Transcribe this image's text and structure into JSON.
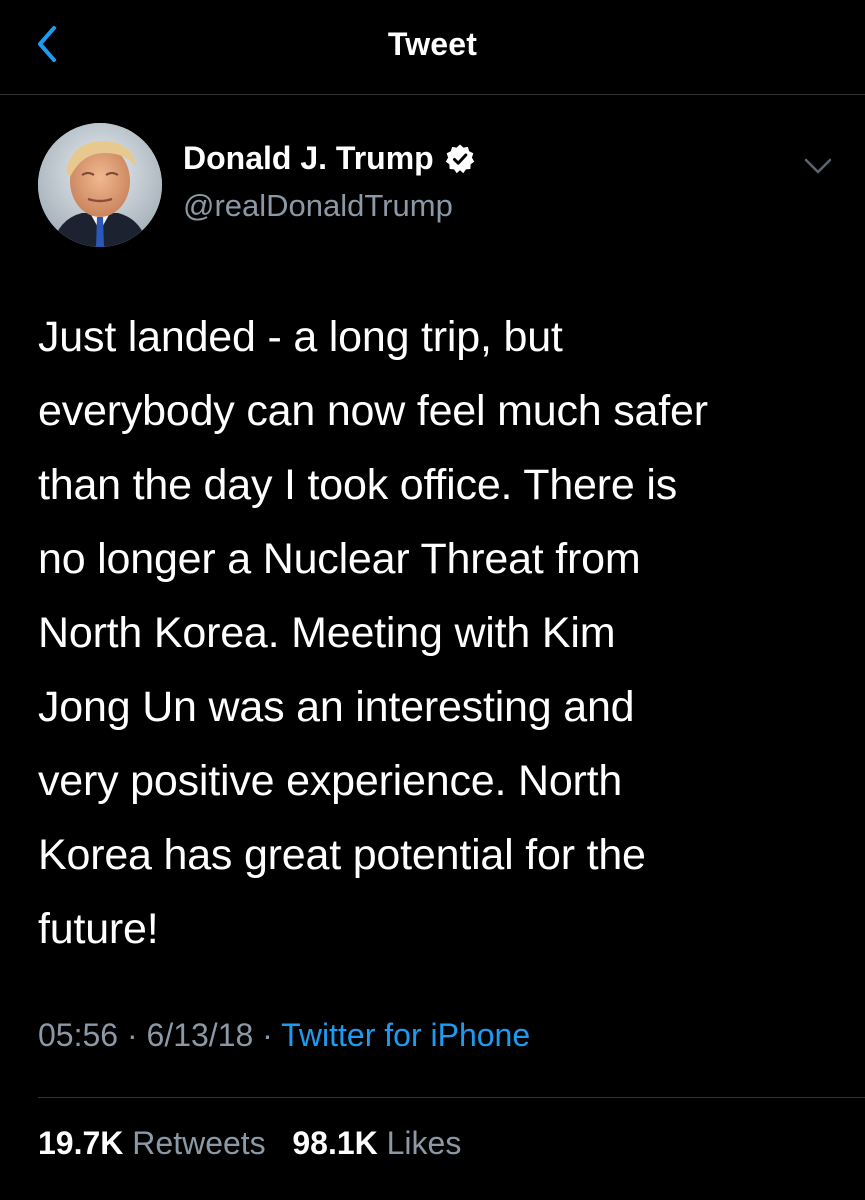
{
  "colors": {
    "background": "#000000",
    "text_primary": "#ffffff",
    "text_secondary": "#8b98a5",
    "accent": "#1d9bf0",
    "divider": "#2f3336"
  },
  "nav": {
    "back_icon": "chevron-left-icon",
    "title": "Tweet"
  },
  "author": {
    "display_name": "Donald J. Trump",
    "verified_icon": "verified-badge-icon",
    "handle": "@realDonaldTrump",
    "menu_icon": "chevron-down-icon"
  },
  "tweet": {
    "lines": [
      "Just landed - a long trip, but",
      "everybody can now feel much safer",
      "than the day I took office. There is",
      "no longer a Nuclear Threat from",
      "North Korea. Meeting with Kim",
      "Jong Un was an interesting and",
      "very positive experience. North",
      "Korea has great potential for the",
      "future!"
    ]
  },
  "meta": {
    "time": "05:56",
    "separator": " · ",
    "date": "6/13/18",
    "source": "Twitter for iPhone"
  },
  "stats": {
    "retweets_count": "19.7K",
    "retweets_label": "Retweets",
    "likes_count": "98.1K",
    "likes_label": "Likes"
  }
}
